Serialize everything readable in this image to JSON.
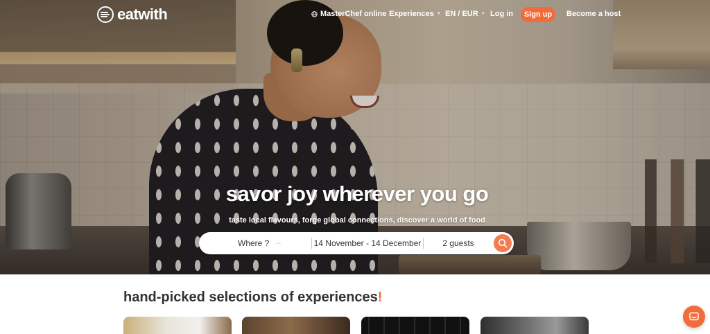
{
  "brand": {
    "name": "eatwith",
    "accent": "#f26b3a"
  },
  "nav": {
    "masterchef": "MasterChef online",
    "experiences": "Experiences",
    "language": "EN / EUR",
    "login": "Log in",
    "signup": "Sign up",
    "become_host": "Become a host"
  },
  "hero": {
    "headline": "savor joy wherever you go",
    "subline": "taste local flavours, forge global connections, discover a world of food"
  },
  "search": {
    "where": "Where ?",
    "where_dash": "--",
    "dates": "14 November - 14 December",
    "guests": "2 guests"
  },
  "section": {
    "title": "hand-picked selections of experiences",
    "title_mark": "!"
  },
  "icons": {
    "globe": "globe-icon",
    "search": "search-icon",
    "chat": "chat-icon",
    "logo": "eatwith-logo-icon"
  }
}
